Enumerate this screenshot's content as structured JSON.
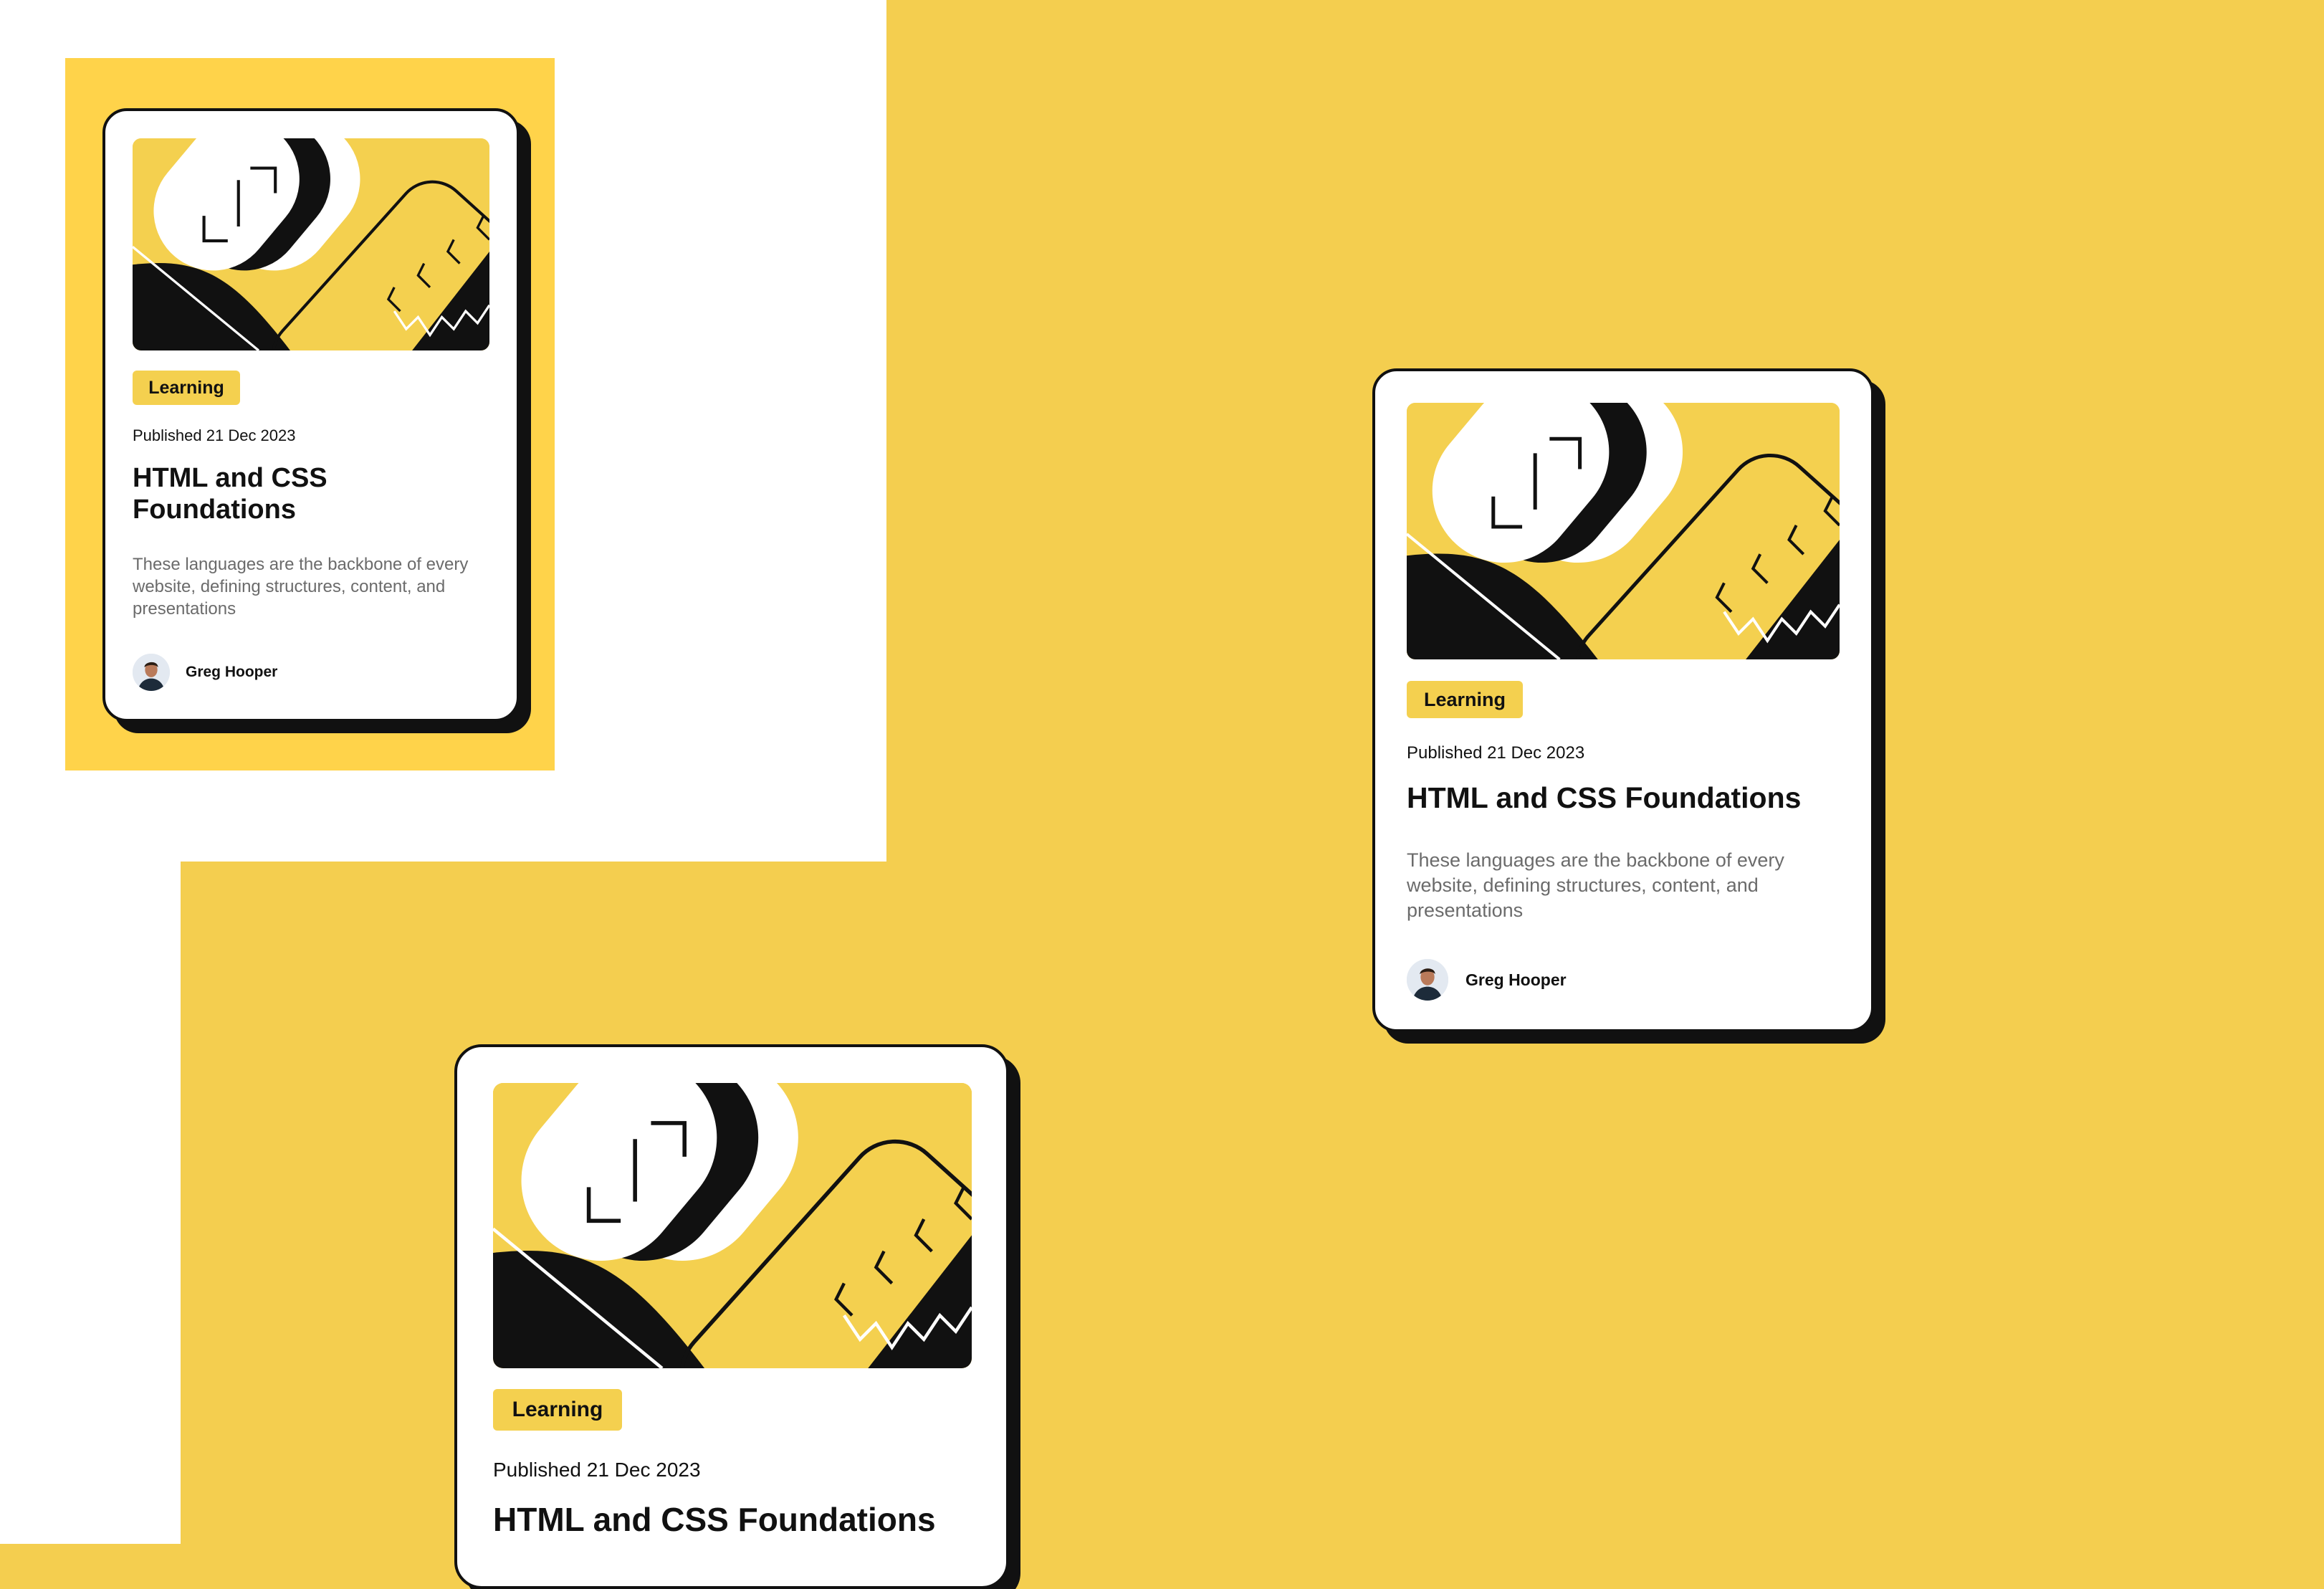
{
  "colors": {
    "background_yellow": "#f4ce4f",
    "mobile_frame_yellow": "#ffd34a",
    "card_white": "#ffffff",
    "ink": "#111111",
    "muted_text": "#6b6b6b",
    "tag_yellow": "#f4d04f"
  },
  "cards": [
    {
      "tag": "Learning",
      "date": "Published 21 Dec 2023",
      "title": "HTML and CSS Foundations",
      "description": "These languages are the backbone of every website, defining structures, content, and presentations",
      "author": "Greg Hooper",
      "illustration_icon": "code-brackets-illustration",
      "avatar_icon": "greg-hooper-avatar"
    },
    {
      "tag": "Learning",
      "date": "Published 21 Dec 2023",
      "title": "HTML and CSS Foundations",
      "description": "These languages are the backbone of every website, defining structures, content, and presentations",
      "author": "Greg Hooper",
      "illustration_icon": "code-brackets-illustration",
      "avatar_icon": "greg-hooper-avatar"
    },
    {
      "tag": "Learning",
      "date": "Published 21 Dec 2023",
      "title": "HTML and CSS Foundations",
      "illustration_icon": "code-brackets-illustration"
    }
  ]
}
